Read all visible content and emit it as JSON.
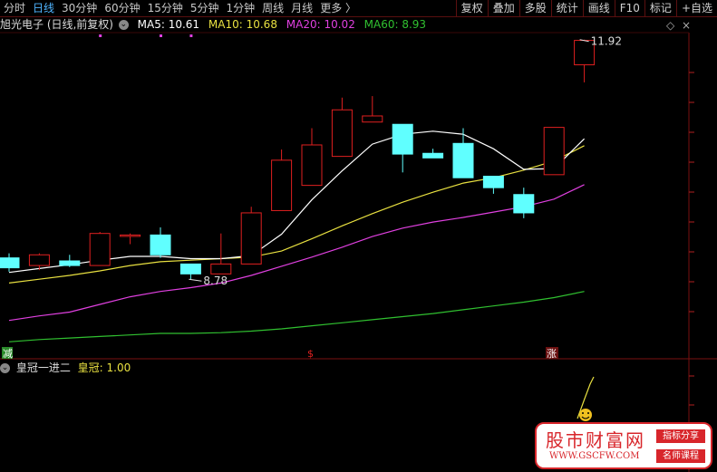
{
  "toolbar": {
    "periods": [
      "分时",
      "日线",
      "30分钟",
      "60分钟",
      "15分钟",
      "5分钟",
      "1分钟",
      "周线",
      "月线",
      "更多 〉"
    ],
    "active_period": "日线",
    "right_tools": [
      "复权",
      "叠加",
      "多股",
      "统计",
      "画线",
      "F10",
      "标记",
      "+自选"
    ]
  },
  "info": {
    "title": "旭光电子 (日线,前复权)",
    "ma5": "MA5: 10.61",
    "ma10": "MA10: 10.68",
    "ma20": "MA20: 10.02",
    "ma60": "MA60: 8.93"
  },
  "colors": {
    "ma5": "#ffffff",
    "ma10": "#e8e040",
    "ma20": "#e040e0",
    "ma60": "#30c030",
    "up": "#e02020",
    "down": "#60ffff"
  },
  "price_labels": {
    "high": "11.92",
    "low": "8.78"
  },
  "markers": {
    "left": "减",
    "mid": "$",
    "right": "涨"
  },
  "sub": {
    "name": "皇冠一进二",
    "value_label": "皇冠: 1.00"
  },
  "watermark": {
    "title": "股市财富网",
    "url": "WWW.GSCFW.COM",
    "tag1": "指标分享",
    "tag2": "名师课程"
  },
  "chart_data": {
    "type": "candlestick",
    "candles": [
      {
        "o": 9.06,
        "c": 8.93,
        "h": 9.12,
        "l": 8.88
      },
      {
        "o": 8.96,
        "c": 9.1,
        "h": 9.12,
        "l": 8.9
      },
      {
        "o": 9.02,
        "c": 8.96,
        "h": 9.1,
        "l": 8.94
      },
      {
        "o": 8.96,
        "c": 9.38,
        "h": 9.4,
        "l": 8.96
      },
      {
        "o": 9.36,
        "c": 9.36,
        "h": 9.38,
        "l": 9.24
      },
      {
        "o": 9.36,
        "c": 9.1,
        "h": 9.46,
        "l": 9.06
      },
      {
        "o": 8.98,
        "c": 8.85,
        "h": 8.98,
        "l": 8.78
      },
      {
        "o": 8.85,
        "c": 8.98,
        "h": 9.38,
        "l": 8.85
      },
      {
        "o": 8.98,
        "c": 9.65,
        "h": 9.73,
        "l": 8.98
      },
      {
        "o": 9.68,
        "c": 10.34,
        "h": 10.48,
        "l": 9.68
      },
      {
        "o": 10.01,
        "c": 10.54,
        "h": 10.76,
        "l": 10.01
      },
      {
        "o": 10.39,
        "c": 11.0,
        "h": 11.16,
        "l": 10.39
      },
      {
        "o": 10.84,
        "c": 10.92,
        "h": 11.18,
        "l": 10.84
      },
      {
        "o": 10.81,
        "c": 10.42,
        "h": 10.81,
        "l": 10.18
      },
      {
        "o": 10.43,
        "c": 10.37,
        "h": 10.49,
        "l": 10.37
      },
      {
        "o": 10.56,
        "c": 10.11,
        "h": 10.76,
        "l": 10.11
      },
      {
        "o": 10.13,
        "c": 9.98,
        "h": 10.13,
        "l": 9.9
      },
      {
        "o": 9.89,
        "c": 9.65,
        "h": 9.98,
        "l": 9.58
      },
      {
        "o": 10.15,
        "c": 10.77,
        "h": 10.77,
        "l": 10.15
      },
      {
        "o": 11.59,
        "c": 11.91,
        "h": 11.92,
        "l": 11.36
      }
    ],
    "ma5": [
      8.87,
      8.92,
      8.97,
      9.03,
      9.08,
      9.08,
      9.05,
      9.05,
      9.09,
      9.37,
      9.82,
      10.2,
      10.55,
      10.68,
      10.72,
      10.68,
      10.49,
      10.22,
      10.23,
      10.62
    ],
    "ma10": [
      8.73,
      8.78,
      8.83,
      8.89,
      8.96,
      9.01,
      9.03,
      9.05,
      9.07,
      9.15,
      9.31,
      9.48,
      9.64,
      9.79,
      9.92,
      10.04,
      10.11,
      10.21,
      10.33,
      10.53
    ],
    "ma20": [
      8.24,
      8.3,
      8.35,
      8.45,
      8.55,
      8.62,
      8.67,
      8.73,
      8.83,
      8.95,
      9.07,
      9.2,
      9.34,
      9.45,
      9.53,
      9.59,
      9.66,
      9.73,
      9.83,
      10.02
    ],
    "ma60": [
      7.96,
      7.99,
      8.01,
      8.03,
      8.05,
      8.07,
      8.07,
      8.08,
      8.1,
      8.13,
      8.17,
      8.21,
      8.25,
      8.29,
      8.33,
      8.38,
      8.43,
      8.48,
      8.54,
      8.62
    ]
  }
}
